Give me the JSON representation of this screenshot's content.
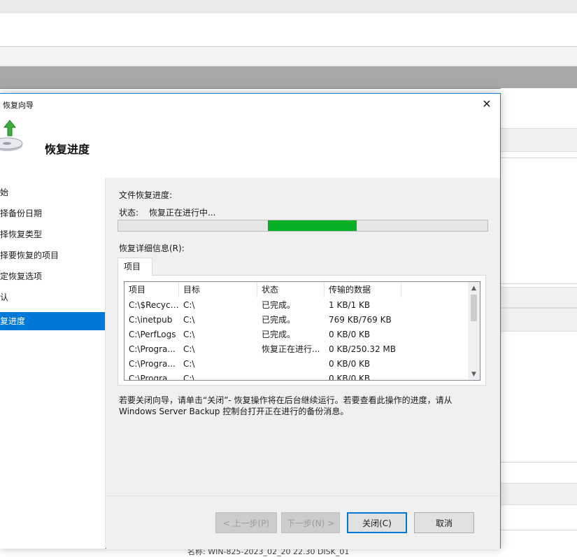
{
  "dialog": {
    "title": "恢复向导",
    "heading": "恢复进度",
    "close_glyph": "✕"
  },
  "nav": {
    "items": [
      {
        "label": "开始",
        "active": false
      },
      {
        "label": "选择备份日期",
        "active": false
      },
      {
        "label": "选择恢复类型",
        "active": false
      },
      {
        "label": "选择要恢复的项目",
        "active": false
      },
      {
        "label": "指定恢复选项",
        "active": false
      },
      {
        "label": "确认",
        "active": false
      },
      {
        "label": "恢复进度",
        "active": true
      }
    ]
  },
  "content": {
    "section_label": "文件恢复进度:",
    "status_label": "状态:",
    "status_value": "恢复正在进行中...",
    "details_label": "恢复详细信息(R):",
    "tab_label": "项目",
    "progress_note": "indeterminate marquee, green segment",
    "columns": [
      "项目",
      "目标",
      "状态",
      "传输的数据"
    ],
    "rows": [
      [
        "C:\\$Recycl...",
        "C:\\",
        "已完成。",
        "1 KB/1 KB"
      ],
      [
        "C:\\inetpub",
        "C:\\",
        "已完成。",
        "769 KB/769 KB"
      ],
      [
        "C:\\PerfLogs",
        "C:\\",
        "已完成。",
        "0 KB/0 KB"
      ],
      [
        "C:\\Progra...",
        "C:\\",
        "恢复正在进行...",
        "0 KB/250.32 MB"
      ],
      [
        "C:\\Progra...",
        "C:\\",
        "",
        "0 KB/0 KB"
      ],
      [
        "C:\\Progra...",
        "C:\\",
        "",
        "0 KB/0 KB"
      ]
    ],
    "info_text": "若要关闭向导，请单击“关闭”- 恢复操作将在后台继续运行。若要查看此操作的进度，请从 Windows Server Backup 控制台打开正在进行的备份消息。"
  },
  "buttons": {
    "prev": "< 上一步(P)",
    "next": "下一步(N) >",
    "close": "关闭(C)",
    "cancel": "取消"
  },
  "background": {
    "bottom_text": "名称:        WIN-825-2023_02_20 22.30 DISK_01"
  },
  "colors": {
    "accent": "#0078d7",
    "progress": "#06b025",
    "dialog_bg": "#f0f0f0"
  }
}
